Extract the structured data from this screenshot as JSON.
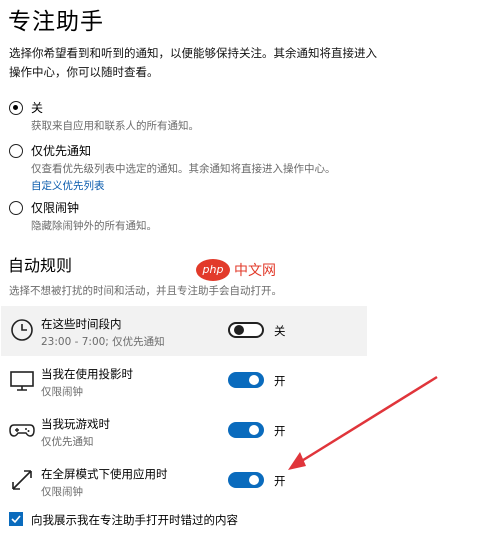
{
  "page": {
    "title": "专注助手",
    "description": "选择你希望看到和听到的通知，以便能够保持关注。其余通知将直接进入操作中心，你可以随时查看。"
  },
  "modes": [
    {
      "label": "关",
      "sub": "获取来自应用和联系人的所有通知。",
      "checked": true
    },
    {
      "label": "仅优先通知",
      "sub": "仅查看优先级列表中选定的通知。其余通知将直接进入操作中心。",
      "link": "自定义优先列表",
      "checked": false
    },
    {
      "label": "仅限闹钟",
      "sub": "隐藏除闹钟外的所有通知。",
      "checked": false
    }
  ],
  "auto_rules": {
    "title": "自动规则",
    "description": "选择不想被打扰的时间和活动，并且专注助手会自动打开。",
    "rules": [
      {
        "icon": "clock-icon",
        "name": "在这些时间段内",
        "sub": "23:00 - 7:00; 仅优先通知",
        "on": false,
        "state": "关"
      },
      {
        "icon": "monitor-icon",
        "name": "当我在使用投影时",
        "sub": "仅限闹钟",
        "on": true,
        "state": "开"
      },
      {
        "icon": "gamepad-icon",
        "name": "当我玩游戏时",
        "sub": "仅优先通知",
        "on": true,
        "state": "开"
      },
      {
        "icon": "fullscreen-icon",
        "name": "在全屏模式下使用应用时",
        "sub": "仅限闹钟",
        "on": true,
        "state": "开"
      }
    ]
  },
  "summary_checkbox": {
    "label": "向我展示我在专注助手打开时错过的内容",
    "checked": true
  },
  "watermark": {
    "logo": "php",
    "text": "中文网"
  },
  "colors": {
    "accent": "#0a6bbd",
    "link": "#0b5cad",
    "annotation_arrow": "#e0353b"
  }
}
